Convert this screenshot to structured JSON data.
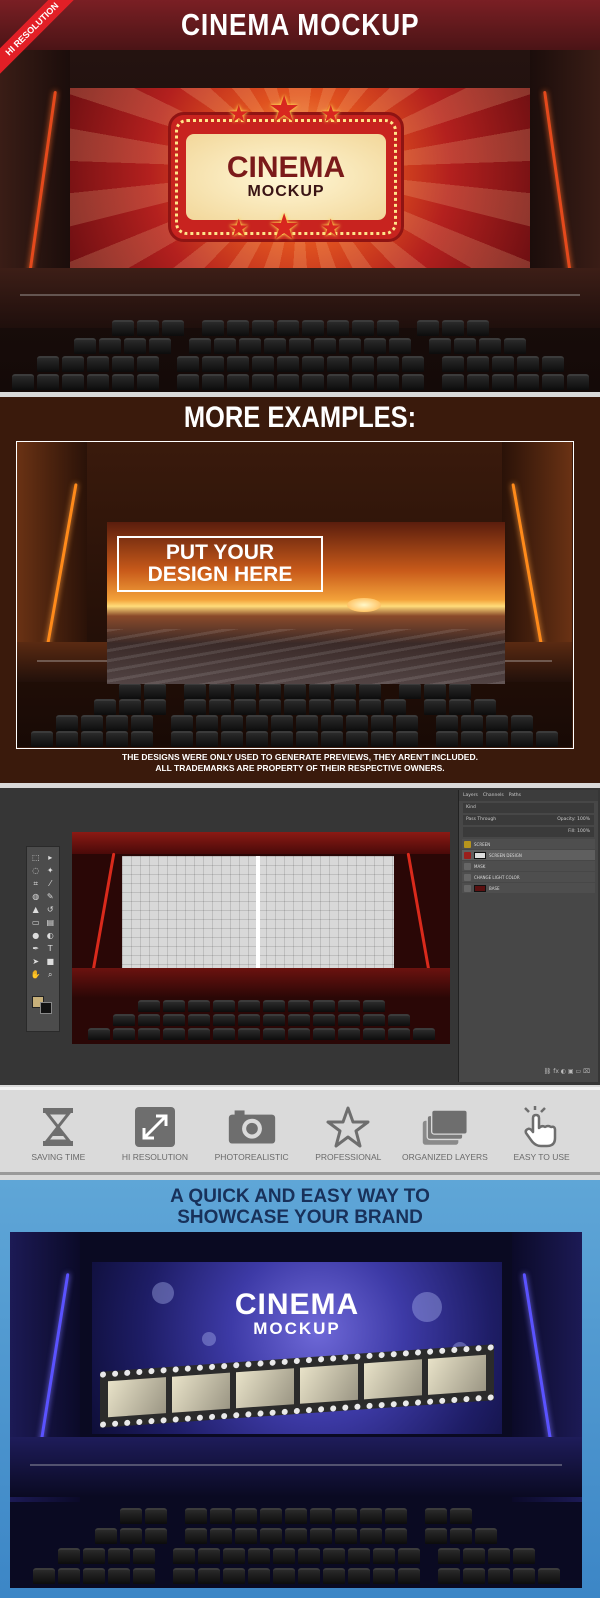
{
  "panel1": {
    "title": "CINEMA MOCKUP",
    "ribbon": "HI RESOLUTION",
    "marquee_big": "CINEMA",
    "marquee_small": "MOCKUP"
  },
  "panel2": {
    "title": "MORE EXAMPLES:",
    "put_line1": "PUT YOUR",
    "put_line2": "DESIGN HERE",
    "disclaimer_line1": "THE DESIGNS WERE ONLY USED TO GENERATE PREVIEWS, THEY AREN'T INCLUDED.",
    "disclaimer_line2": "ALL TRADEMARKS ARE PROPERTY OF THEIR RESPECTIVE OWNERS."
  },
  "panel3": {
    "tabs": [
      "Layers",
      "Channels",
      "Paths"
    ],
    "opt1": "Kind",
    "opt2": "Pass Through",
    "opacity": "Opacity: 100%",
    "fill": "Fill: 100%",
    "layers": [
      "SCREEN",
      "SCREEN DESIGN",
      "MASK",
      "CHANGE LIGHT COLOR",
      "BASE"
    ]
  },
  "features": [
    {
      "icon": "hourglass-icon",
      "label": "SAVING TIME"
    },
    {
      "icon": "expand-icon",
      "label": "HI RESOLUTION"
    },
    {
      "icon": "camera-icon",
      "label": "PHOTOREALISTIC"
    },
    {
      "icon": "star-icon",
      "label": "PROFESSIONAL"
    },
    {
      "icon": "layers-icon",
      "label": "ORGANIZED LAYERS"
    },
    {
      "icon": "pointer-hand-icon",
      "label": "EASY TO USE"
    }
  ],
  "panel5": {
    "tagline_line1": "A QUICK AND EASY WAY TO",
    "tagline_line2": "SHOWCASE YOUR BRAND",
    "brand_big": "CINEMA",
    "brand_small": "MOCKUP"
  },
  "colors": {
    "header_red": "#7a1f24",
    "ribbon_red": "#e21f26",
    "feature_gray": "#6a6a6a",
    "tagline_navy": "#18315a",
    "sky_blue": "#5fa6d7"
  }
}
